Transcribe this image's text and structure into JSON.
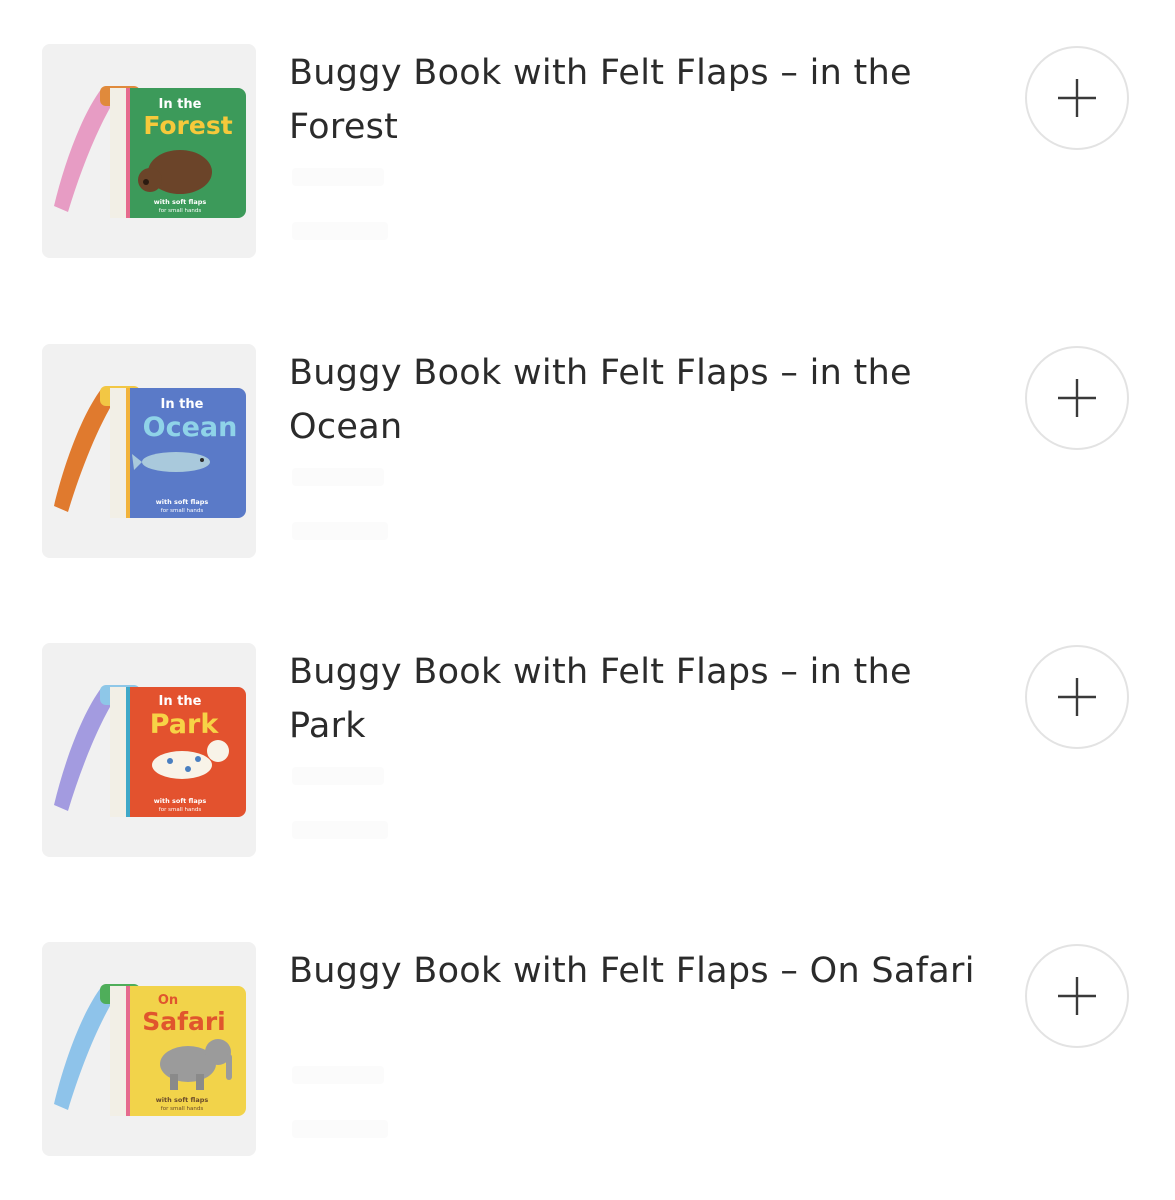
{
  "products": [
    {
      "title": "Buggy Book with Felt Flaps – in the Forest",
      "cover": {
        "line1": "In the",
        "line2": "Forest",
        "tagline1": "with soft flaps",
        "tagline2": "for small hands",
        "cover_color": "#3c9a5a",
        "strap_color": "#e79cc4",
        "tab_color": "#e08a3c",
        "spine_color": "#f2efe6",
        "title_color": "#f6c93b",
        "animal": "bear"
      }
    },
    {
      "title": "Buggy Book with Felt Flaps – in the Ocean",
      "cover": {
        "line1": "In the",
        "line2": "Ocean",
        "tagline1": "with soft flaps",
        "tagline2": "for small hands",
        "cover_color": "#5a7ac8",
        "strap_color": "#e07a2e",
        "tab_color": "#f2c744",
        "spine_color": "#f2efe6",
        "title_color": "#8fd3e8",
        "animal": "dolphin"
      }
    },
    {
      "title": "Buggy Book with Felt Flaps – in the Park",
      "cover": {
        "line1": "In the",
        "line2": "Park",
        "tagline1": "with soft flaps",
        "tagline2": "for small hands",
        "cover_color": "#e3522e",
        "strap_color": "#a39be0",
        "tab_color": "#8ec7e8",
        "spine_color": "#f2efe6",
        "title_color": "#f7d346",
        "animal": "dog"
      }
    },
    {
      "title": "Buggy Book with Felt Flaps – On Safari",
      "cover": {
        "line1": "On",
        "line2": "Safari",
        "tagline1": "with soft flaps",
        "tagline2": "for small hands",
        "cover_color": "#f2d34a",
        "strap_color": "#8ec3ea",
        "tab_color": "#4fae5a",
        "spine_color": "#f2efe6",
        "title_color": "#e0552d",
        "animal": "elephant"
      }
    }
  ],
  "add_button_icon": "plus-icon",
  "colors": {
    "thumb_bg": "#f1f1f1",
    "text": "#2b2b2b",
    "button_border": "#e3e3e3"
  }
}
